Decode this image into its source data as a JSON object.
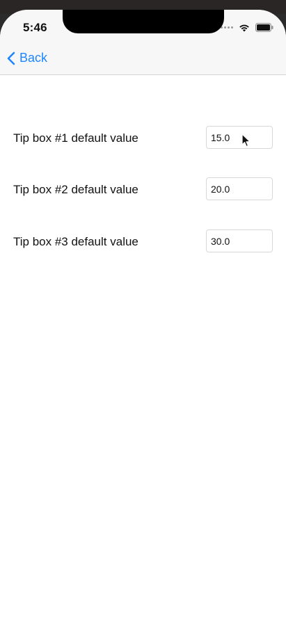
{
  "status_bar": {
    "time": "5:46",
    "icons": [
      "signal-dots-icon",
      "wifi-icon",
      "battery-icon"
    ]
  },
  "nav": {
    "back_label": "Back",
    "accent_color": "#1e86ff"
  },
  "settings": [
    {
      "label": "Tip box #1 default value",
      "value": "15.0"
    },
    {
      "label": "Tip box #2 default value",
      "value": "20.0"
    },
    {
      "label": "Tip box #3 default value",
      "value": "30.0"
    }
  ]
}
